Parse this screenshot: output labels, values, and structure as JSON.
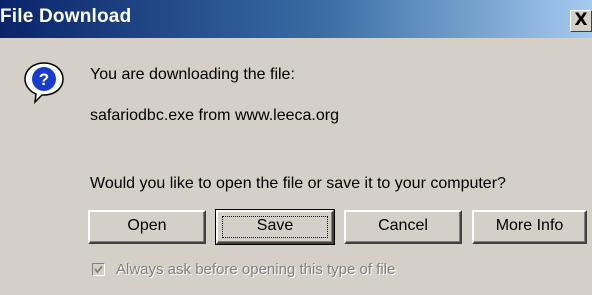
{
  "window": {
    "title": "File Download",
    "close_label": "X"
  },
  "message": {
    "line1": "You are downloading the file:",
    "file_line": "safariodbc.exe from www.leeca.org",
    "question": "Would you like to open the file or save it to your computer?"
  },
  "buttons": {
    "open": "Open",
    "save": "Save",
    "cancel": "Cancel",
    "more_info": "More Info"
  },
  "checkbox": {
    "label": "Always ask before opening this type of file",
    "checked": true,
    "disabled": true
  },
  "icons": {
    "message": "question-icon",
    "close": "close-icon"
  },
  "colors": {
    "titlebar_start": "#0a246a",
    "titlebar_end": "#a6caf0",
    "dialog_bg": "#d4d0c8"
  }
}
